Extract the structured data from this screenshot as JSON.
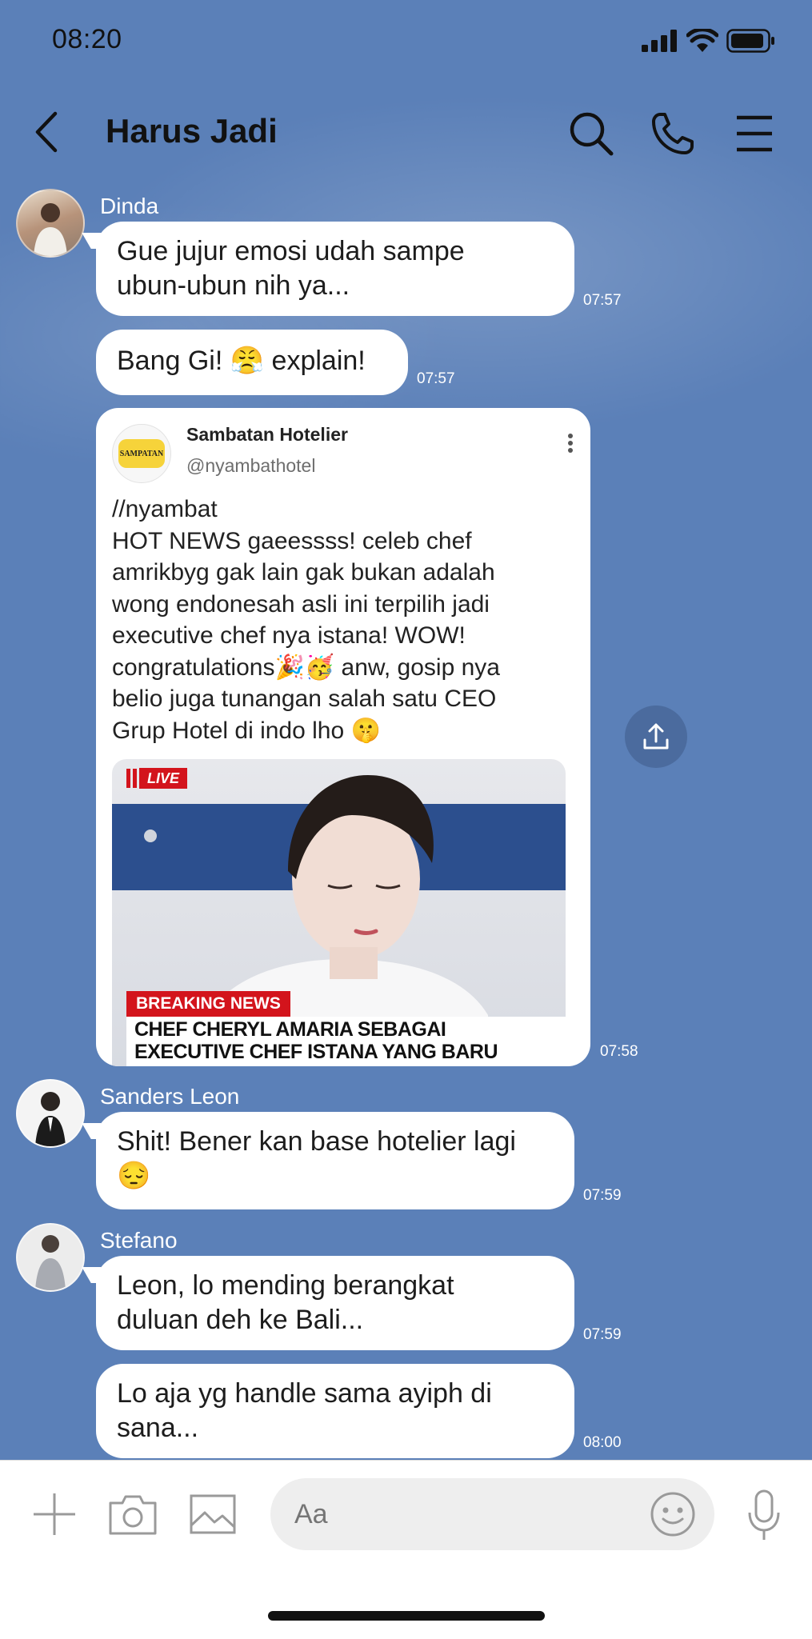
{
  "status": {
    "time": "08:20"
  },
  "header": {
    "title": "Harus Jadi"
  },
  "messages": {
    "m1": {
      "sender": "Dinda",
      "line1": "Gue jujur emosi udah sampe",
      "line2": "ubun-ubun nih ya...",
      "time": "07:57"
    },
    "m2": {
      "text_a": "Bang Gi! ",
      "emoji": "😤",
      "text_b": " explain!",
      "time": "07:57"
    },
    "m3": {
      "card_name": "Sambatan Hotelier",
      "card_handle": "@nyambathotel",
      "logo_text": "SAMPATAN",
      "lines": [
        "//nyambat",
        "HOT NEWS gaeessss! celeb chef",
        "amrikbyg gak lain gak bukan adalah",
        "wong endonesah asli ini terpilih jadi",
        "executive chef nya istana! WOW!",
        "congratulations🎉🥳 anw, gosip nya",
        "belio juga tunangan salah satu CEO",
        "Grup Hotel di indo lho 🤫"
      ],
      "live_label": "LIVE",
      "breaking_label": "BREAKING NEWS",
      "headline1": "CHEF CHERYL AMARIA SEBAGAI",
      "headline2": "EXECUTIVE CHEF ISTANA YANG BARU",
      "time": "07:58"
    },
    "m4": {
      "sender": "Sanders Leon",
      "line1": "Shit! Bener kan base hotelier lagi",
      "line2": "😔",
      "time": "07:59"
    },
    "m5": {
      "sender": "Stefano",
      "line1": "Leon, lo mending berangkat",
      "line2": "duluan deh  ke Bali...",
      "time": "07:59"
    },
    "m6": {
      "line1": "Lo aja yg handle sama ayiph di",
      "line2": "sana...",
      "time": "08:00"
    }
  },
  "input": {
    "placeholder": "Aa"
  }
}
